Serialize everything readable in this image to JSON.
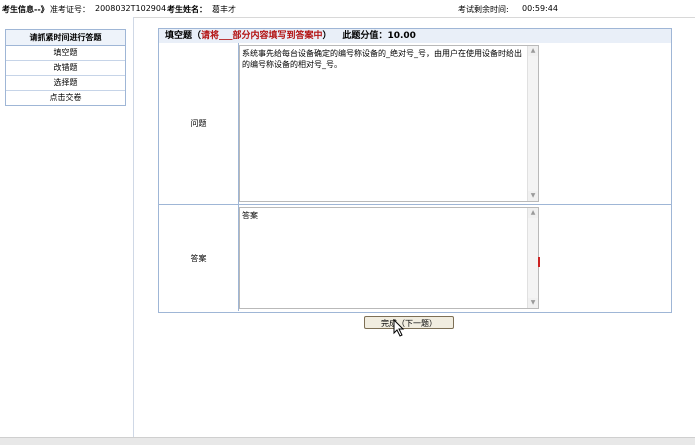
{
  "header": {
    "examinee_info_label": "考生信息--》",
    "exam_id_label": "准考证号：",
    "exam_id_value": "2008032T102904",
    "name_label": "考生姓名：",
    "name_value": "葛丰才",
    "time_left_label": "考试剩余时间:",
    "time_left_value": "00:59:44"
  },
  "sidebar": {
    "title": "请抓紧时间进行答题",
    "items": [
      {
        "label": "填空题"
      },
      {
        "label": "改错题"
      },
      {
        "label": "选择题"
      },
      {
        "label": "点击交卷"
      }
    ]
  },
  "question": {
    "type_label": "填空题（",
    "instruction": "请将___部分内容填写到答案中",
    "type_label_end": "）",
    "score_label": "此题分值：",
    "score_value": "10.00",
    "question_label": "问题",
    "question_text": "系统事先给每台设备确定的编号称设备的_绝对号_号，由用户在使用设备时给出的编号称设备的相对号_号。",
    "answer_label": "答案",
    "answer_text": "答案"
  },
  "actions": {
    "next_label": "完成（下一题）"
  },
  "colors": {
    "header_bg": "#e9eff8",
    "border": "#9fb6d6",
    "instruction_red": "#b31212"
  }
}
